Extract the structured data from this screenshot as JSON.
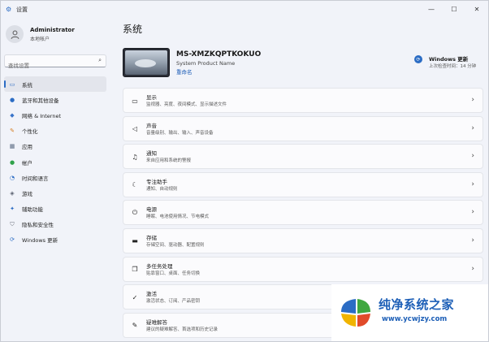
{
  "window": {
    "title": "设置",
    "controls": {
      "minimize": "—",
      "maximize": "☐",
      "close": "✕"
    }
  },
  "profile": {
    "name": "Administrator",
    "account_type": "本地帐户"
  },
  "search": {
    "placeholder": "查找设置"
  },
  "sidebar": {
    "items": [
      {
        "label": "系统",
        "icon": "monitor-icon",
        "color": "#2b6cc4",
        "active": true
      },
      {
        "label": "蓝牙和其他设备",
        "icon": "bluetooth-icon",
        "color": "#2b6cc4"
      },
      {
        "label": "网络 & Internet",
        "icon": "network-icon",
        "color": "#3a74c9"
      },
      {
        "label": "个性化",
        "icon": "brush-icon",
        "color": "#d47c1e"
      },
      {
        "label": "应用",
        "icon": "apps-icon",
        "color": "#5a6b82"
      },
      {
        "label": "帐户",
        "icon": "account-icon",
        "color": "#2fa24a"
      },
      {
        "label": "时间和语言",
        "icon": "clock-icon",
        "color": "#2b6cc4"
      },
      {
        "label": "游戏",
        "icon": "gamepad-icon",
        "color": "#5a6070"
      },
      {
        "label": "辅助功能",
        "icon": "accessibility-icon",
        "color": "#2b6cc4"
      },
      {
        "label": "隐私和安全性",
        "icon": "shield-icon",
        "color": "#6a6f7a"
      },
      {
        "label": "Windows 更新",
        "icon": "update-icon",
        "color": "#2b6cc4"
      }
    ]
  },
  "main": {
    "page_title": "系统",
    "device": {
      "name": "MS-XMZKQPTKOKUO",
      "model": "System Product Name",
      "rename_link": "重命名"
    },
    "update": {
      "title": "Windows 更新",
      "subtitle": "上次检查时间：14 分钟"
    },
    "cards": [
      {
        "title": "显示",
        "subtitle": "监视器、亮度、夜间模式、显示描述文件",
        "icon": "display-icon"
      },
      {
        "title": "声音",
        "subtitle": "音量级别、输出、输入、声音设备",
        "icon": "speaker-icon"
      },
      {
        "title": "通知",
        "subtitle": "来自应用和系统的警报",
        "icon": "bell-icon"
      },
      {
        "title": "专注助手",
        "subtitle": "通知、自动规则",
        "icon": "moon-icon"
      },
      {
        "title": "电源",
        "subtitle": "睡眠、电池使用情况、节电模式",
        "icon": "power-icon"
      },
      {
        "title": "存储",
        "subtitle": "存储空间、驱动器、配置规则",
        "icon": "storage-icon"
      },
      {
        "title": "多任务处理",
        "subtitle": "贴靠窗口、桌面、任务切换",
        "icon": "multitask-icon"
      },
      {
        "title": "激活",
        "subtitle": "激活状态、订阅、产品密钥",
        "icon": "check-circle-icon"
      },
      {
        "title": "疑难解答",
        "subtitle": "建议的疑难解答、首选项和历史记录",
        "icon": "wrench-icon"
      }
    ]
  },
  "watermark": {
    "name": "纯净系统之家",
    "url": "www.ycwjzy.com"
  },
  "colors": {
    "accent": "#2b6cc4",
    "background": "#f1f3f9",
    "card": "#fbfbfd",
    "watermark_blue": "#1d5fb7"
  }
}
